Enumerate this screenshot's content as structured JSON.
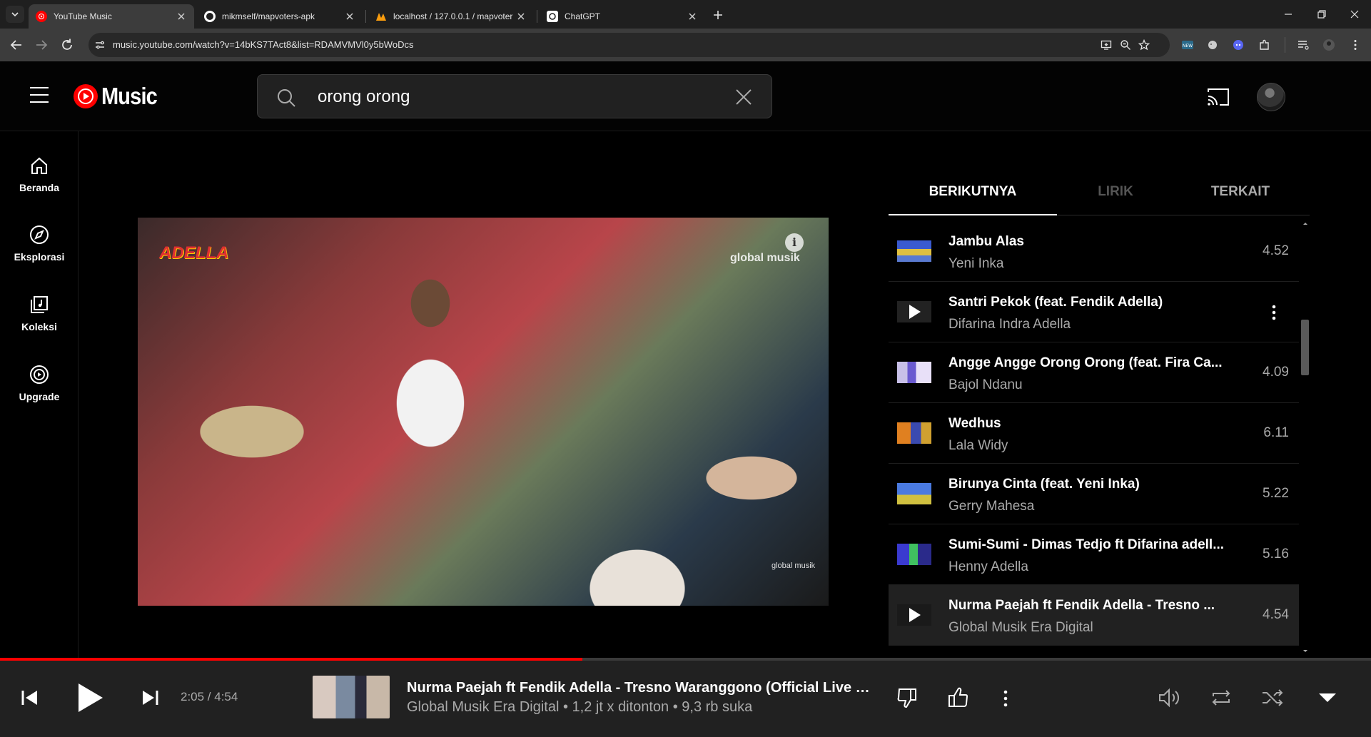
{
  "browser": {
    "tabs": [
      {
        "title": "YouTube Music",
        "icon": "youtube-music-icon",
        "active": true
      },
      {
        "title": "mikmself/mapvoters-apk",
        "icon": "github-icon",
        "active": false
      },
      {
        "title": "localhost / 127.0.0.1 / mapvoter",
        "icon": "phpmyadmin-icon",
        "active": false
      },
      {
        "title": "ChatGPT",
        "icon": "chatgpt-icon",
        "active": false
      }
    ],
    "url": "music.youtube.com/watch?v=14bKS7TAct8&list=RDAMVMVl0y5bWoDcs"
  },
  "header": {
    "logo_text": "Music",
    "search_value": "orong orong"
  },
  "nav": [
    {
      "label": "Beranda",
      "icon": "home-icon"
    },
    {
      "label": "Eksplorasi",
      "icon": "compass-icon"
    },
    {
      "label": "Koleksi",
      "icon": "library-icon"
    },
    {
      "label": "Upgrade",
      "icon": "upgrade-icon"
    }
  ],
  "video": {
    "overlay_logo": "ADELLA",
    "watermark": "global musik",
    "watermark_small": "global musik"
  },
  "panel": {
    "tabs": [
      "BERIKUTNYA",
      "LIRIK",
      "TERKAIT"
    ],
    "queue": [
      {
        "title": "Jambu Alas",
        "artist": "Yeni Inka",
        "duration": "4.52"
      },
      {
        "title": "Santri Pekok (feat. Fendik Adella)",
        "artist": "Difarina Indra Adella",
        "duration": ""
      },
      {
        "title": "Angge Angge Orong Orong (feat. Fira Ca...",
        "artist": "Bajol Ndanu",
        "duration": "4.09"
      },
      {
        "title": "Wedhus",
        "artist": "Lala Widy",
        "duration": "6.11"
      },
      {
        "title": "Birunya Cinta (feat. Yeni Inka)",
        "artist": "Gerry Mahesa",
        "duration": "5.22"
      },
      {
        "title": "Sumi-Sumi - Dimas Tedjo ft Difarina adell...",
        "artist": "Henny Adella",
        "duration": "5.16"
      },
      {
        "title": "Nurma Paejah ft Fendik Adella - Tresno ...",
        "artist": "Global Musik Era Digital",
        "duration": "4.54"
      }
    ]
  },
  "player": {
    "time": "2:05 / 4:54",
    "progress": 0.425,
    "title": "Nurma Paejah ft Fendik Adella - Tresno Waranggono (Official Live Mu...",
    "subtitle": "Global Musik Era Digital • 1,2 jt x ditonton • 9,3 rb suka"
  },
  "colors": {
    "accent": "#ff0000",
    "background": "#030303",
    "player_bg": "#212121"
  }
}
